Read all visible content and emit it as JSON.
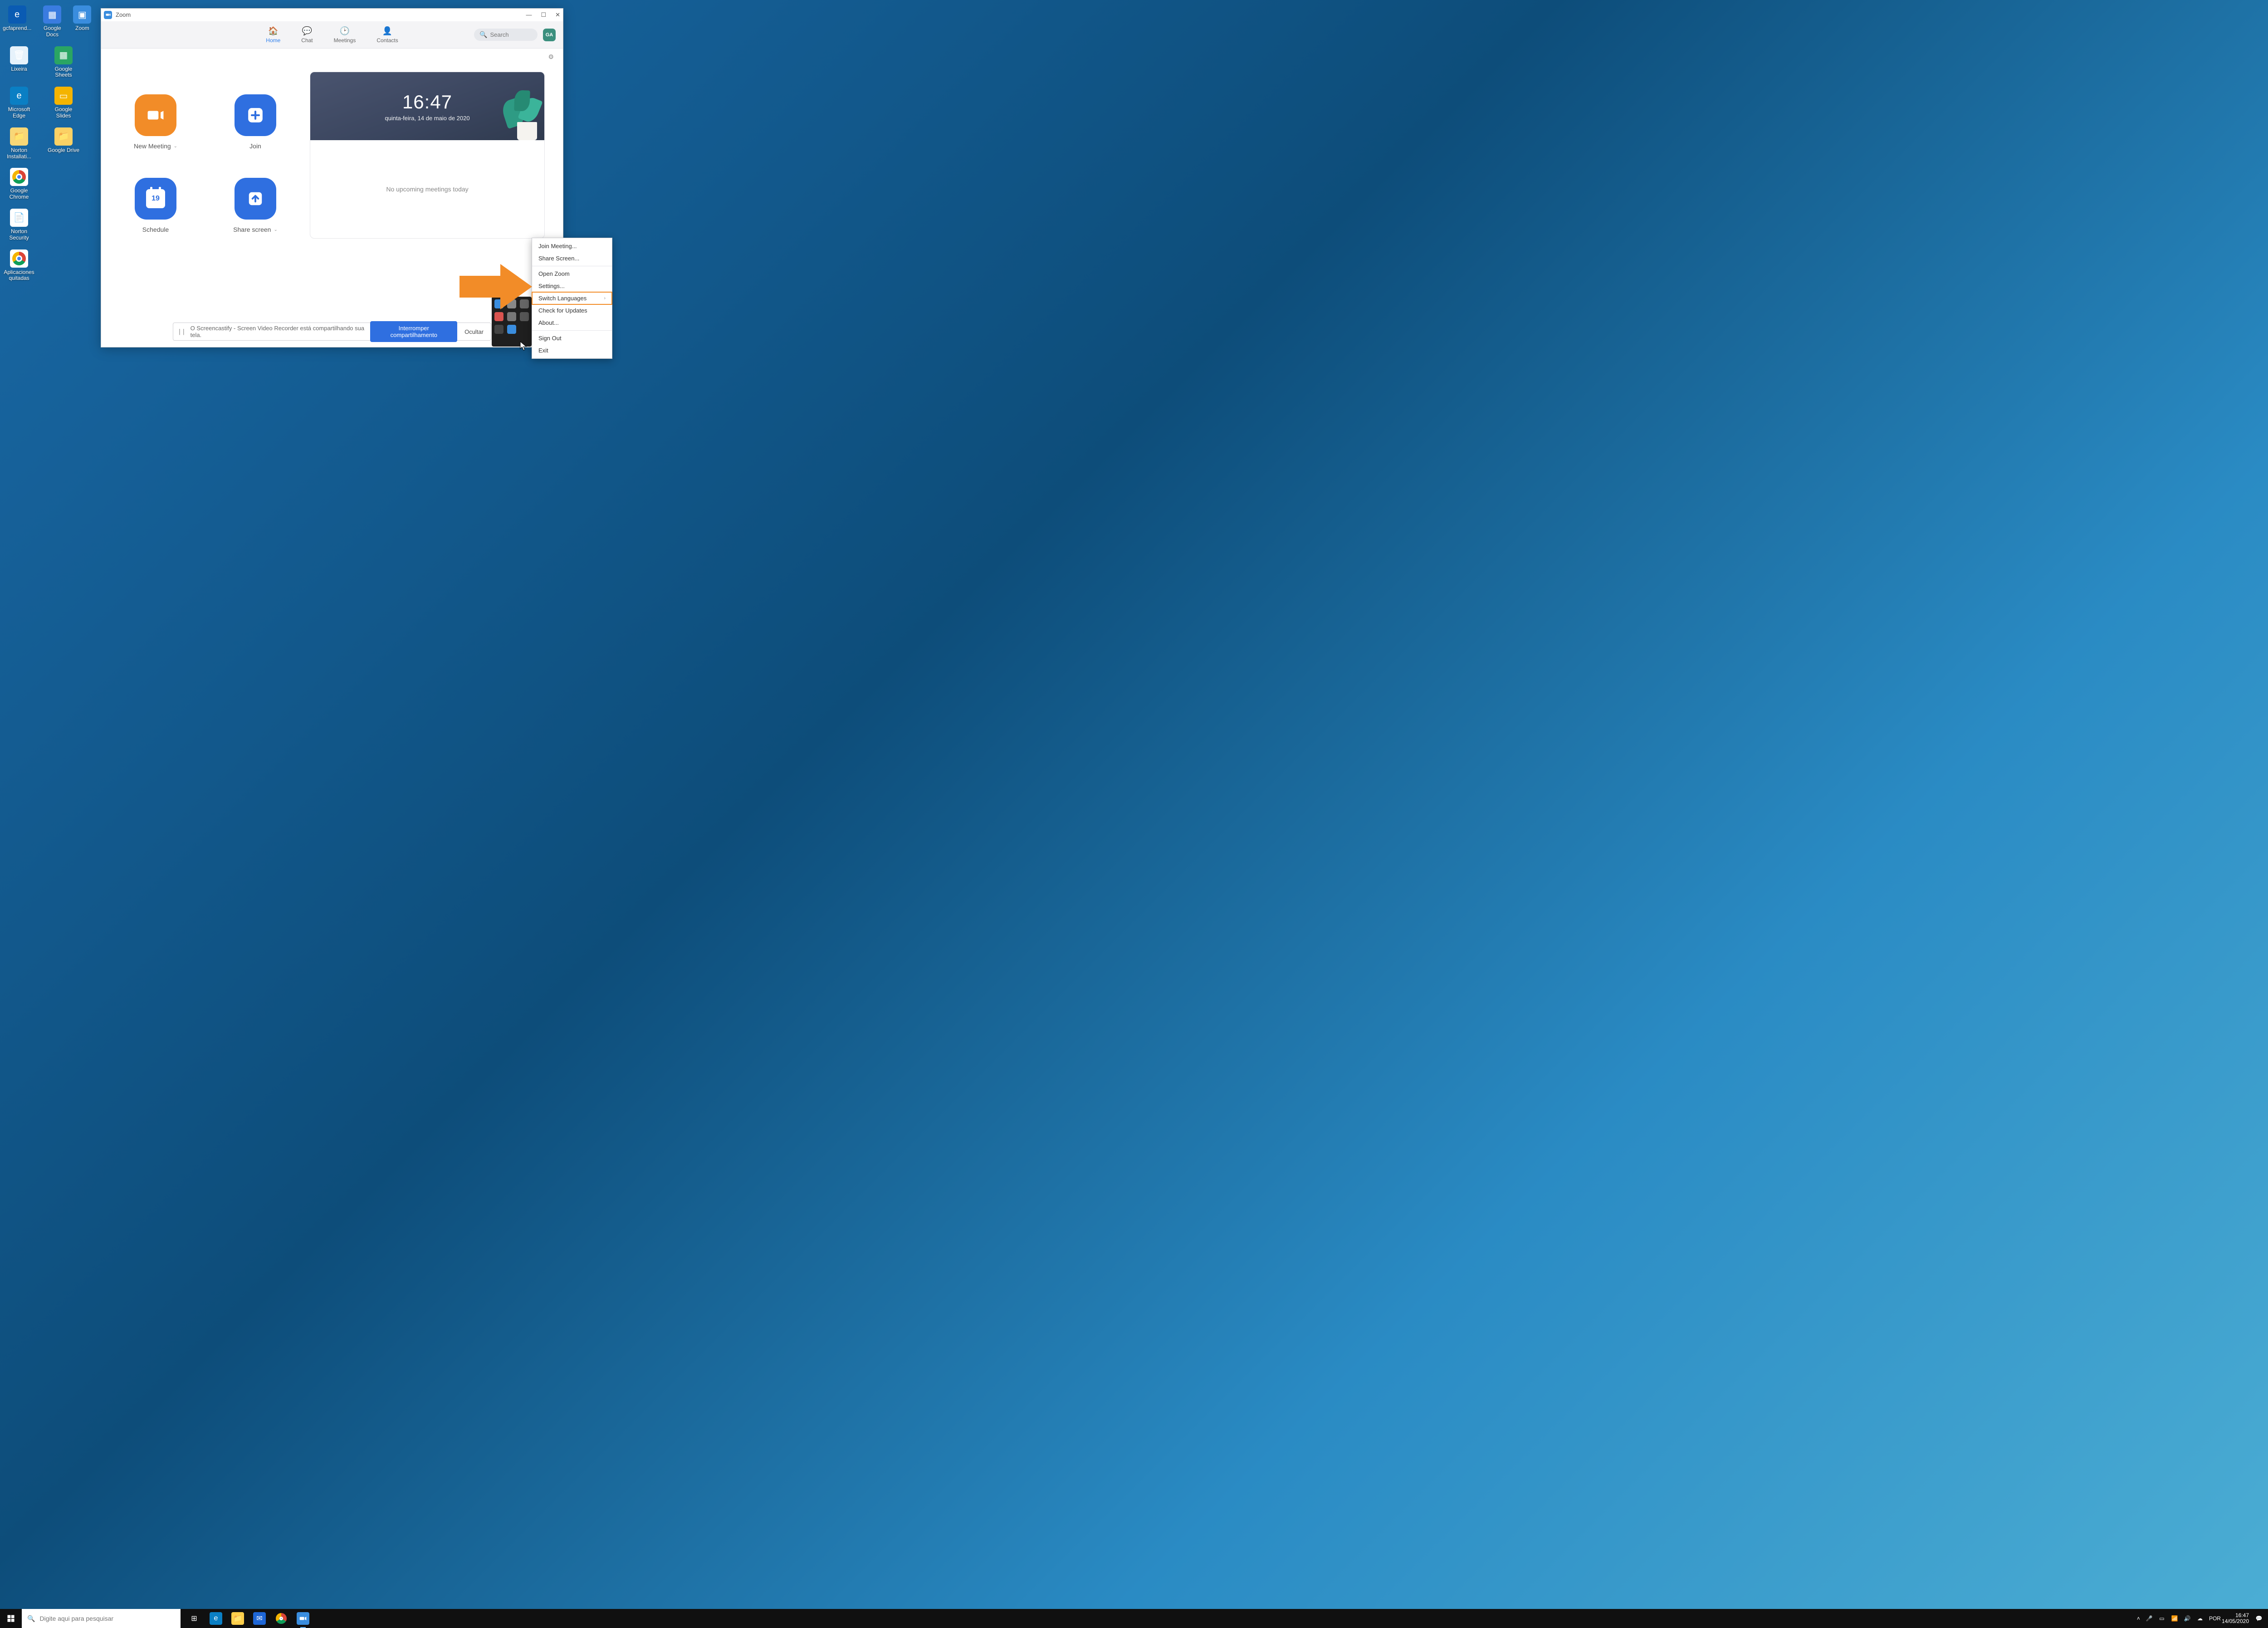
{
  "desktop_icons": {
    "gcf": "gcfaprend...",
    "gdocs": "Google Docs",
    "zoom": "Zoom",
    "trash": "Lixeira",
    "gsheets": "Google Sheets",
    "medge": "Microsoft Edge",
    "gslides": "Google Slides",
    "norton_inst": "Norton Installati...",
    "gdrive": "Google Drive",
    "chrome": "Google Chrome",
    "norton_sec": "Norton Security",
    "apq": "Aplicaciones quitadas"
  },
  "zoom": {
    "title": "Zoom",
    "nav": {
      "home": "Home",
      "chat": "Chat",
      "meetings": "Meetings",
      "contacts": "Contacts"
    },
    "search_placeholder": "Search",
    "avatar": "GA",
    "actions": {
      "new_meeting": "New Meeting",
      "join": "Join",
      "schedule": "Schedule",
      "schedule_day": "19",
      "share_screen": "Share screen"
    },
    "clock": {
      "time": "16:47",
      "date": "quinta-feira, 14 de maio de 2020"
    },
    "no_upcoming": "No upcoming meetings today",
    "sharebar": {
      "msg": "O Screencastify - Screen Video Recorder está compartilhando sua tela.",
      "stop": "Interromper compartilhamento",
      "hide": "Ocultar"
    }
  },
  "context_menu": {
    "join": "Join Meeting...",
    "share": "Share Screen...",
    "open": "Open Zoom",
    "settings": "Settings...",
    "switch_lang": "Switch Languages",
    "updates": "Check for Updates",
    "about": "About...",
    "signout": "Sign Out",
    "exit": "Exit"
  },
  "taskbar": {
    "search_placeholder": "Digite aqui para pesquisar",
    "lang": "POR",
    "time": "16:47",
    "date": "14/05/2020"
  }
}
